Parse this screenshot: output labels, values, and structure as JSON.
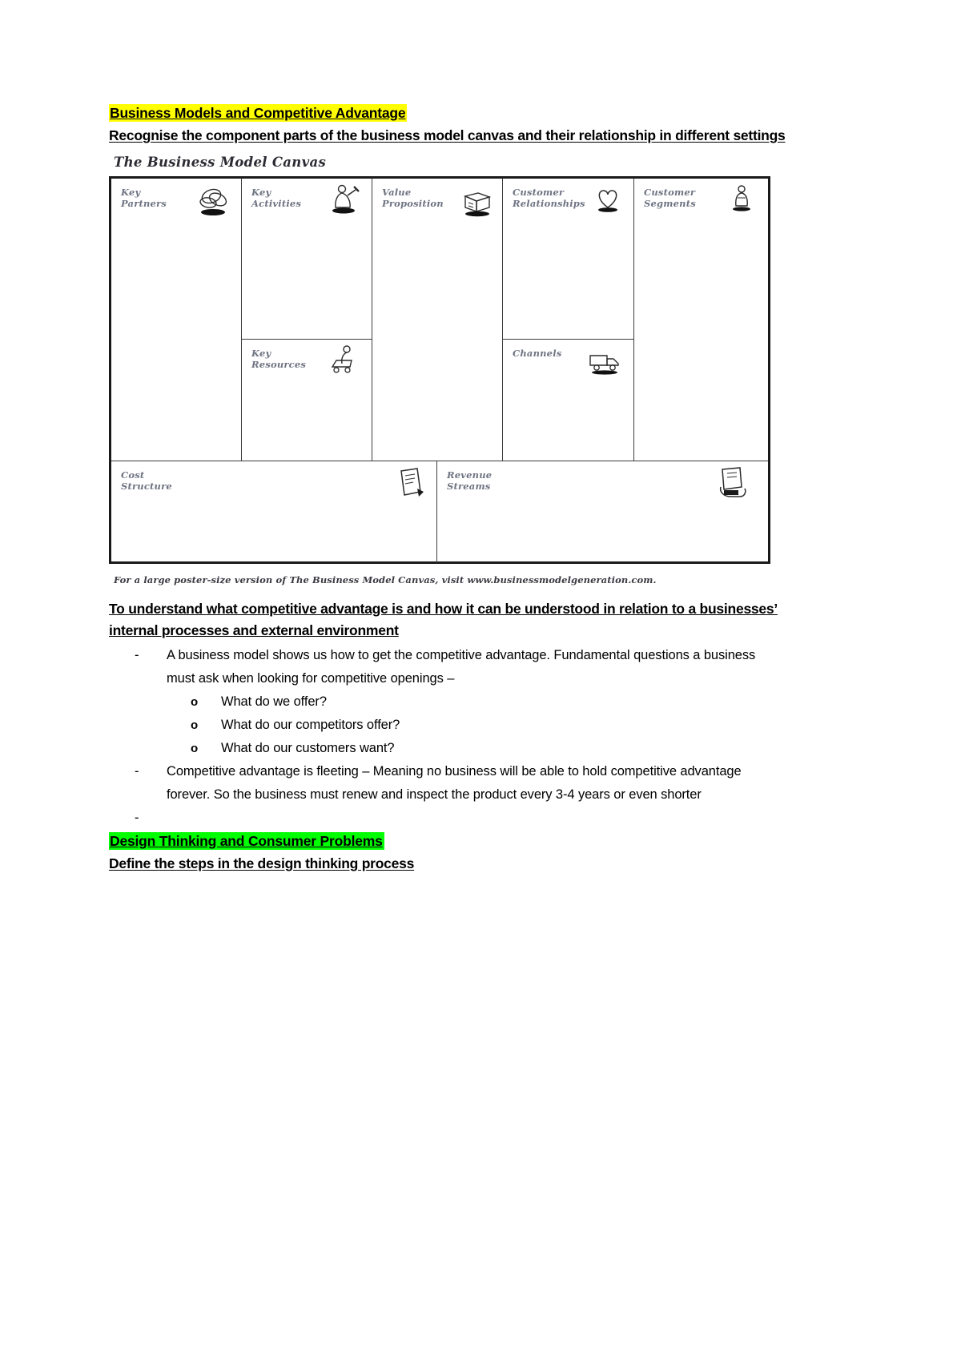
{
  "document": {
    "sections": {
      "topic1_heading": "Business Models and Competitive Advantage",
      "topic1_objective": "Recognise the component parts of the business model canvas and their relationship in different settings",
      "topic2_heading": "Design Thinking and Consumer Problems",
      "topic2_objective": "Define the steps in the design thinking process "
    },
    "highlight_colors": {
      "topic1": "#ffff00",
      "topic2": "#00ff00"
    }
  },
  "figure": {
    "title": "The Business Model Canvas",
    "caption": "For a large poster-size version of The Business Model Canvas, visit www.businessmodelgeneration.com.",
    "blocks": [
      {
        "label": "Key\nPartners",
        "icon": "chain-links-icon"
      },
      {
        "label": "Key\nActivities",
        "icon": "person-hammer-icon"
      },
      {
        "label": "Value\nProposition",
        "icon": "gift-package-icon"
      },
      {
        "label": "Customer\nRelationships",
        "icon": "heart-icon"
      },
      {
        "label": "Customer\nSegments",
        "icon": "people-group-icon"
      },
      {
        "label": "Key\nResources",
        "icon": "person-cart-icon"
      },
      {
        "label": "Channels",
        "icon": "delivery-truck-icon"
      },
      {
        "label": "Cost\nStructure",
        "icon": "price-tag-icon"
      },
      {
        "label": "Revenue\nStreams",
        "icon": "money-hand-icon"
      }
    ]
  },
  "notes": {
    "heading": "To understand what competitive advantage is and how it can be understood in relation to a businesses’ internal processes and external environment",
    "bullets": [
      {
        "marker": "-",
        "text": "A business model shows us how to get the competitive advantage. Fundamental questions a business must ask when looking for competitive openings –",
        "children": [
          {
            "marker": "o",
            "text": "What do we offer?"
          },
          {
            "marker": "o",
            "text": "What do our competitors offer?"
          },
          {
            "marker": "o",
            "text": "What do our customers want?"
          }
        ]
      },
      {
        "marker": "-",
        "text": "Competitive advantage is fleeting – Meaning no business will be able to hold competitive advantage forever. So the business must renew and inspect the product every 3-4 years or even shorter",
        "children": []
      },
      {
        "marker": "-",
        "text": "",
        "children": []
      }
    ]
  }
}
